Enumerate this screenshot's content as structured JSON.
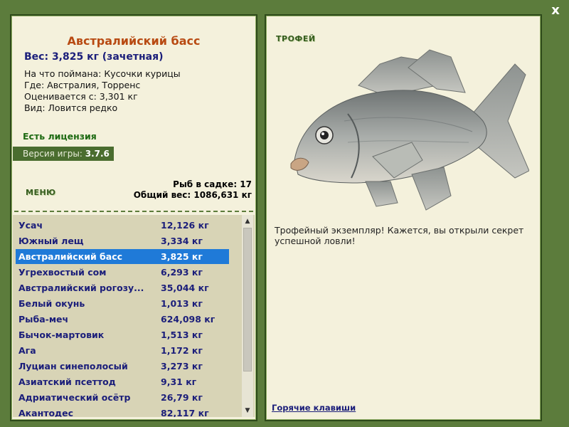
{
  "window": {
    "close_label": "x"
  },
  "fish": {
    "title": "Австралийский басс",
    "weight_line": "Вес: 3,825 кг (зачетная)",
    "bait_line": "На что поймана: Кусочки курицы",
    "where_line": "Где: Австралия, Торренс",
    "value_line": "Оценивается с: 3,301 кг",
    "rarity_line": "Вид: Ловится редко"
  },
  "license": {
    "label": "Есть лицензия"
  },
  "version": {
    "label": "Версия игры:",
    "value": "3.7.6"
  },
  "menu": {
    "label": "МЕНЮ"
  },
  "catch": {
    "count_line": "Рыб в садке: 17",
    "weight_line": "Общий вес: 1086,631 кг"
  },
  "catch_list": {
    "selected_index": 2,
    "rows": [
      {
        "name": "Усач",
        "weight": "12,126 кг"
      },
      {
        "name": "Южный лещ",
        "weight": "3,334 кг"
      },
      {
        "name": "Австралийский басс",
        "weight": "3,825 кг"
      },
      {
        "name": "Угрехвостый сом",
        "weight": "6,293 кг"
      },
      {
        "name": "Австралийский рогозу...",
        "weight": "35,044 кг"
      },
      {
        "name": "Белый окунь",
        "weight": "1,013 кг"
      },
      {
        "name": "Рыба-меч",
        "weight": "624,098 кг"
      },
      {
        "name": "Бычок-мартовик",
        "weight": "1,513 кг"
      },
      {
        "name": "Ага",
        "weight": "1,172 кг"
      },
      {
        "name": "Луциан синеполосый",
        "weight": "3,273 кг"
      },
      {
        "name": "Азиатский псеттод",
        "weight": "9,31 кг"
      },
      {
        "name": "Адриатический осётр",
        "weight": "26,79 кг"
      },
      {
        "name": "Акантодес",
        "weight": "82,117 кг"
      }
    ]
  },
  "trophy": {
    "label": "ТРОФЕЙ",
    "text": "Трофейный экземпляр! Кажется, вы открыли секрет успешной ловли!"
  },
  "hotkeys": {
    "label": "Горячие клавиши"
  },
  "colors": {
    "background": "#5c7c3c",
    "panel": "#f4f1dc",
    "title": "#b84a12",
    "list_text": "#1b1e7a",
    "selected": "#1f7ad8",
    "license": "#1d6a12"
  }
}
